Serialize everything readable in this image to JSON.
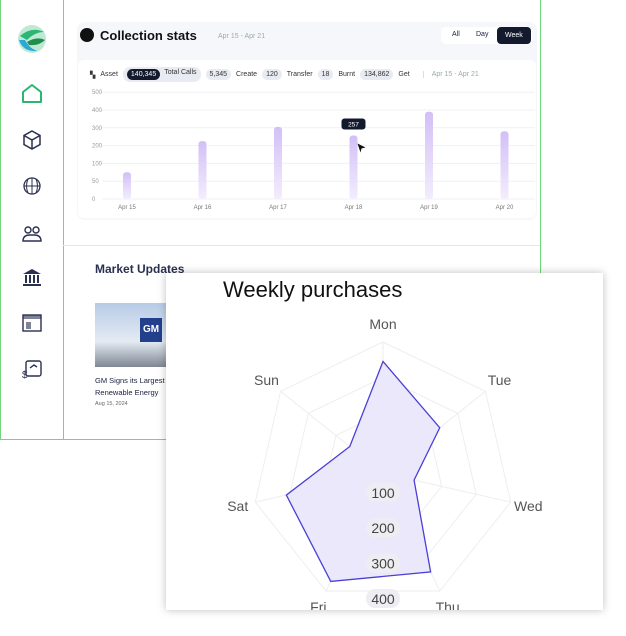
{
  "sidebar": {
    "items": [
      {
        "icon": "logo-icon"
      },
      {
        "icon": "home-icon",
        "active": true
      },
      {
        "icon": "cube-icon"
      },
      {
        "icon": "globe-icon"
      },
      {
        "icon": "users-icon"
      },
      {
        "icon": "bank-icon"
      },
      {
        "icon": "storefront-icon"
      },
      {
        "icon": "exchange-icon"
      }
    ],
    "accent": "#2bb673"
  },
  "stats": {
    "title": "Collection stats",
    "range": "Apr 15 - Apr 21",
    "tabs": [
      "All",
      "Day",
      "Week"
    ],
    "active_tab": "Week",
    "asset_label": "Asset",
    "total_calls": "140,345",
    "total_calls_label": "Total Calls",
    "create": "5,345",
    "create_label": "Create",
    "transfer": "120",
    "transfer_label": "Transfer",
    "burnt": "18",
    "burnt_label": "Burnt",
    "get": "134,862",
    "get_label": "Get",
    "range2": "Apr 15 - Apr 21"
  },
  "market": {
    "title": "Market Updates",
    "news": [
      {
        "image_text": "GM",
        "title": "GM Signs its Largest Renewable Energy De",
        "date": "Aug 15, 2024"
      }
    ]
  },
  "chart_data": [
    {
      "type": "bar",
      "categories": [
        "Apr 15",
        "Apr 16",
        "Apr 17",
        "Apr 18",
        "Apr 19",
        "Apr 20"
      ],
      "values": [
        75,
        225,
        305,
        257,
        390,
        280
      ],
      "yticks": [
        "0",
        "50",
        "100",
        "200",
        "300",
        "400",
        "500"
      ],
      "tooltip": "257",
      "grid": true,
      "color": "#cdb8f5"
    },
    {
      "type": "radar",
      "title": "Weekly purchases",
      "categories": [
        "Mon",
        "Tue",
        "Wed",
        "Thu",
        "Fri",
        "Sat",
        "Sun"
      ],
      "values": [
        345,
        235,
        120,
        340,
        370,
        310,
        150
      ],
      "rticks": [
        "100",
        "200",
        "300",
        "400"
      ],
      "color": "#4a3fd6",
      "fill": "#e8e6f9"
    }
  ]
}
